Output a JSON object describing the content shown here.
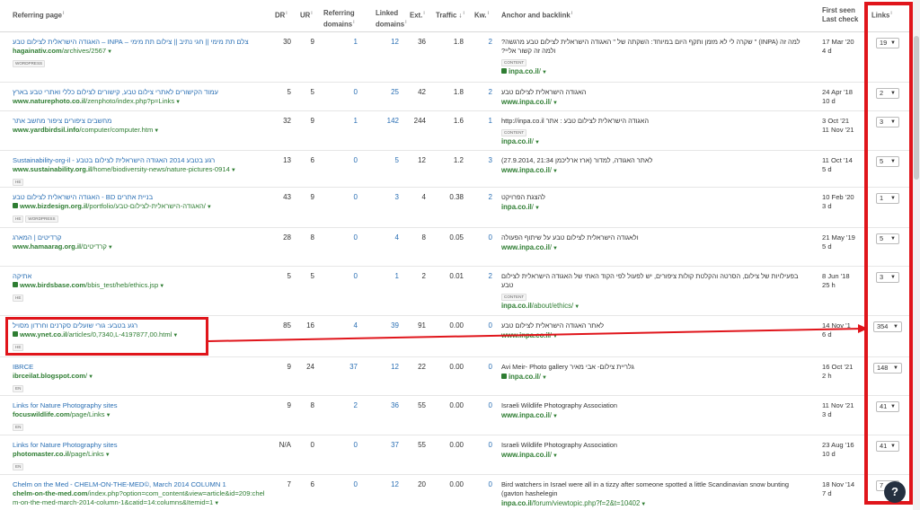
{
  "headers": {
    "referring_page": "Referring page",
    "dr": "DR",
    "ur": "UR",
    "referring_domains": "Referring domains",
    "linked_domains": "Linked domains",
    "ext": "Ext.",
    "traffic": "Traffic ↓",
    "kw": "Kw.",
    "anchor": "Anchor and backlink",
    "first_seen": "First seen",
    "last_check": "Last check",
    "links": "Links"
  },
  "rows": [
    {
      "title": "צלם תת מימי || חגי נתיב || צילום תת מימי – INPA – האגודה הישראלית לצילום טבע",
      "domain": "hagainativ.com",
      "path": "/archives/2567",
      "secure": false,
      "badges": [
        "WORDPRESS"
      ],
      "dr": "30",
      "ur": "9",
      "ref_domains": "1",
      "linked_domains": "12",
      "ext": "36",
      "traffic": "1.8",
      "kw": "2",
      "anchor_text": "למה זה (INPA) \" שקרה לי לא מזמן ותקף היום במיוחד: השקתה של \" האגודה הישראלית לצילום טבע מרגשה? ולמה זה קשור אליי?",
      "anchor_badge": "CONTENT",
      "backlink_domain": "inpa.co.il",
      "backlink_path": "/",
      "backlink_secure": true,
      "first_seen": "17 Mar '20",
      "last_check": "4 d",
      "links": "19"
    },
    {
      "title": "עמוד הקישורים לאתרי צילום טבע, קישורים לצילום כללי ואתרי טבע בארץ",
      "domain": "www.naturephoto.co.il",
      "path": "/zenphoto/index.php?p=Links",
      "secure": false,
      "badges": [],
      "dr": "5",
      "ur": "5",
      "ref_domains": "0",
      "linked_domains": "25",
      "ext": "42",
      "traffic": "1.8",
      "kw": "2",
      "anchor_text": "האגודה הישראלית לצילום טבע",
      "anchor_badge": "",
      "backlink_domain": "www.inpa.co.il",
      "backlink_path": "/",
      "backlink_secure": false,
      "first_seen": "24 Apr '18",
      "last_check": "10 d",
      "links": "2"
    },
    {
      "title": "מחשבים ציפורים ציפור מחשב אתר",
      "domain": "www.yardbirdsil.info",
      "path": "/computer/computer.htm",
      "secure": false,
      "badges": [],
      "dr": "32",
      "ur": "9",
      "ref_domains": "1",
      "linked_domains": "142",
      "ext": "244",
      "traffic": "1.6",
      "kw": "1",
      "anchor_text": "האגודה הישראלית לצילום טבע : אתר http://inpa.co.il",
      "anchor_badge": "CONTENT",
      "backlink_domain": "inpa.co.il",
      "backlink_path": "/",
      "backlink_secure": false,
      "first_seen": "3 Oct '21",
      "last_check": "11 Nov '21",
      "links": "3"
    },
    {
      "title": "Sustainability-org-il - רגע בטבע 2014 האגודה הישראלית לצילום בטבע",
      "domain": "www.sustainability.org.il",
      "path": "/home/biodiversity-news/nature-pictures-0914",
      "secure": false,
      "badges": [
        "HE"
      ],
      "dr": "13",
      "ur": "6",
      "ref_domains": "0",
      "linked_domains": "5",
      "ext": "12",
      "traffic": "1.2",
      "kw": "3",
      "anchor_text": "לאתר האגודה, למדור (ארז ארליכמן 21:34 ,27.9.2014)",
      "anchor_badge": "",
      "backlink_domain": "www.inpa.co.il",
      "backlink_path": "/",
      "backlink_secure": false,
      "first_seen": "11 Oct '14",
      "last_check": "5 d",
      "links": "5"
    },
    {
      "title": "בניית אתרים BD - האגודה הישראלית לצילום טבע",
      "domain": "www.bizdesign.org.il",
      "path": "/portfolio/האגודה-הישראלית-לצילום-טבע/",
      "secure": true,
      "badges": [
        "HE",
        "WORDPRESS"
      ],
      "dr": "43",
      "ur": "9",
      "ref_domains": "0",
      "linked_domains": "3",
      "ext": "4",
      "traffic": "0.38",
      "kw": "2",
      "anchor_text": "להצגת הפרויקט",
      "anchor_badge": "",
      "backlink_domain": "inpa.co.il",
      "backlink_path": "/",
      "backlink_secure": false,
      "first_seen": "10 Feb '20",
      "last_check": "3 d",
      "links": "1"
    },
    {
      "title": "קרדיטים | המארג",
      "domain": "www.hamaarag.org.il",
      "path": "/קרדיטים",
      "secure": false,
      "badges": [],
      "dr": "28",
      "ur": "8",
      "ref_domains": "0",
      "linked_domains": "4",
      "ext": "8",
      "traffic": "0.05",
      "kw": "0",
      "anchor_text": "ולאגודה הישראלית לצילום טבע על שיתוף הפעולה",
      "anchor_badge": "",
      "backlink_domain": "www.inpa.co.il",
      "backlink_path": "/",
      "backlink_secure": false,
      "first_seen": "21 May '19",
      "last_check": "5 d",
      "links": "5"
    },
    {
      "title": "אתיקה",
      "domain": "www.birdsbase.com",
      "path": "/bbis_test/heb/ethics.jsp",
      "secure": true,
      "badges": [
        "HE"
      ],
      "dr": "5",
      "ur": "5",
      "ref_domains": "0",
      "linked_domains": "1",
      "ext": "2",
      "traffic": "0.01",
      "kw": "2",
      "anchor_text": "בפעילויות של צילום, הסרטה והקלטת קולות ציפורים, יש לפעול לפי הקוד האתי של האגודה הישראלית לצילום טבע",
      "anchor_badge": "CONTENT",
      "backlink_domain": "inpa.co.il",
      "backlink_path": "/about/ethics/",
      "backlink_secure": false,
      "first_seen": "8 Jun '18",
      "last_check": "25 h",
      "links": "3"
    },
    {
      "title": "רגע בטבע: גורי שועלים סקרנים וחרדון מסויל",
      "domain": "www.ynet.co.il",
      "path": "/articles/0,7340,L-4197877,00.html",
      "secure": true,
      "badges": [
        "HE"
      ],
      "dr": "85",
      "ur": "16",
      "ref_domains": "4",
      "linked_domains": "39",
      "ext": "91",
      "traffic": "0.00",
      "kw": "0",
      "anchor_text": "לאתר האגודה הישראלית לצילום טבע",
      "anchor_badge": "",
      "backlink_domain": "www.inpa.co.il",
      "backlink_path": "/",
      "backlink_secure": false,
      "first_seen": "14 Nov '1",
      "last_check": "6 d",
      "links": "354"
    },
    {
      "title": "IBRCE",
      "domain": "ibrceilat.blogspot.com",
      "path": "/",
      "secure": false,
      "badges": [
        "EN"
      ],
      "dr": "9",
      "ur": "24",
      "ref_domains": "37",
      "linked_domains": "12",
      "ext": "22",
      "traffic": "0.00",
      "kw": "0",
      "anchor_text": "Avi Meir- Photo gallery גלריית צילום- אבי מאיר",
      "anchor_badge": "",
      "backlink_domain": "inpa.co.il",
      "backlink_path": "/",
      "backlink_secure": true,
      "first_seen": "16 Oct '21",
      "last_check": "2 h",
      "links": "148"
    },
    {
      "title": "Links for Nature Photography sites",
      "domain": "focuswildlife.com",
      "path": "/page/Links",
      "secure": false,
      "badges": [
        "EN"
      ],
      "dr": "9",
      "ur": "8",
      "ref_domains": "2",
      "linked_domains": "36",
      "ext": "55",
      "traffic": "0.00",
      "kw": "0",
      "anchor_text": "Israeli Wildlife Photography Association",
      "anchor_badge": "",
      "backlink_domain": "www.inpa.co.il",
      "backlink_path": "/",
      "backlink_secure": false,
      "first_seen": "11 Nov '21",
      "last_check": "3 d",
      "links": "41"
    },
    {
      "title": "Links for Nature Photography sites",
      "domain": "photomaster.co.il",
      "path": "/page/Links",
      "secure": false,
      "badges": [
        "EN"
      ],
      "dr": "N/A",
      "ur": "0",
      "ref_domains": "0",
      "linked_domains": "37",
      "ext": "55",
      "traffic": "0.00",
      "kw": "0",
      "anchor_text": "Israeli Wildlife Photography Association",
      "anchor_badge": "",
      "backlink_domain": "www.inpa.co.il",
      "backlink_path": "/",
      "backlink_secure": false,
      "first_seen": "23 Aug '16",
      "last_check": "10 d",
      "links": "41"
    },
    {
      "title": "Chelm on the Med - CHELM-ON-THE-MED©, March 2014 COLUMN 1",
      "domain": "chelm-on-the-med.com",
      "path": "/index.php?option=com_content&view=article&id=209:chelm-on-the-med-march-2014-column-1&catid=14:columns&Itemid=1",
      "secure": false,
      "badges": [],
      "dr": "7",
      "ur": "6",
      "ref_domains": "0",
      "linked_domains": "12",
      "ext": "20",
      "traffic": "0.00",
      "kw": "0",
      "anchor_text": "Bird watchers in Israel were all in a tizzy after someone spotted a little Scandinavian snow bunting (gavton hashelegin",
      "anchor_badge": "",
      "backlink_domain": "inpa.co.il",
      "backlink_path": "/forum/viewtopic.php?f=2&t=10402",
      "backlink_secure": false,
      "first_seen": "18 Nov '14",
      "last_check": "7 d",
      "links": "7"
    }
  ],
  "help_label": "?"
}
